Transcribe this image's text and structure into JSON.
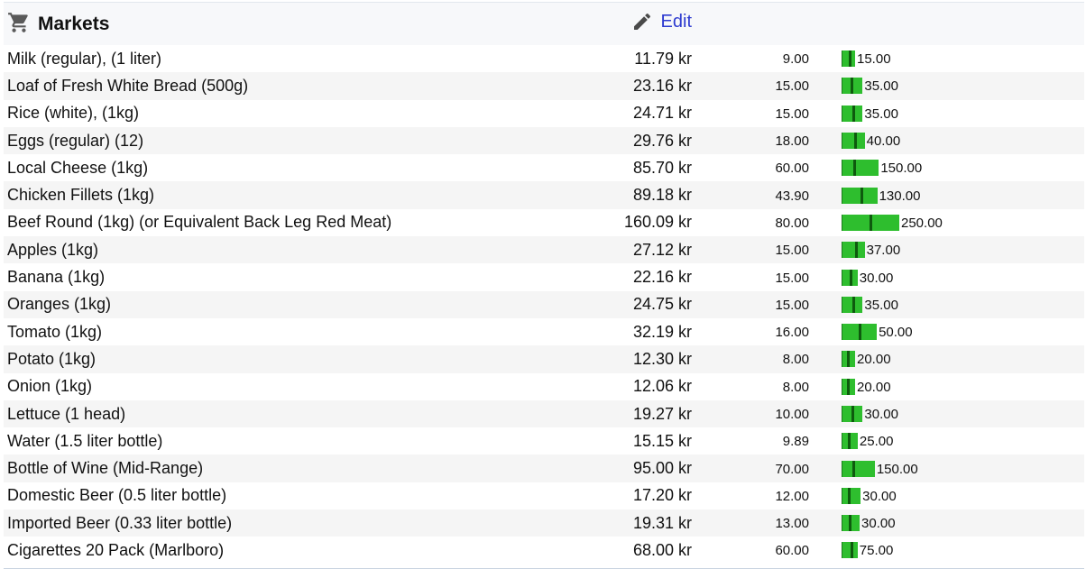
{
  "category": {
    "title": "Markets",
    "icon": "shopping-cart-icon",
    "edit_label": "Edit",
    "edit_icon": "pencil-icon"
  },
  "colors": {
    "bar": "#2ebe2e",
    "bar_marker": "#0e5a0e",
    "link": "#2e3bd0",
    "row_alt": "#f5f5f5"
  },
  "items": [
    {
      "name": "Milk (regular), (1 liter)",
      "price": "11.79 kr",
      "min": "9.00",
      "max": "15.00"
    },
    {
      "name": "Loaf of Fresh White Bread (500g)",
      "price": "23.16 kr",
      "min": "15.00",
      "max": "35.00"
    },
    {
      "name": "Rice (white), (1kg)",
      "price": "24.71 kr",
      "min": "15.00",
      "max": "35.00"
    },
    {
      "name": "Eggs (regular) (12)",
      "price": "29.76 kr",
      "min": "18.00",
      "max": "40.00"
    },
    {
      "name": "Local Cheese (1kg)",
      "price": "85.70 kr",
      "min": "60.00",
      "max": "150.00"
    },
    {
      "name": "Chicken Fillets (1kg)",
      "price": "89.18 kr",
      "min": "43.90",
      "max": "130.00"
    },
    {
      "name": "Beef Round (1kg) (or Equivalent Back Leg Red Meat)",
      "price": "160.09 kr",
      "min": "80.00",
      "max": "250.00"
    },
    {
      "name": "Apples (1kg)",
      "price": "27.12 kr",
      "min": "15.00",
      "max": "37.00"
    },
    {
      "name": "Banana (1kg)",
      "price": "22.16 kr",
      "min": "15.00",
      "max": "30.00"
    },
    {
      "name": "Oranges (1kg)",
      "price": "24.75 kr",
      "min": "15.00",
      "max": "35.00"
    },
    {
      "name": "Tomato (1kg)",
      "price": "32.19 kr",
      "min": "16.00",
      "max": "50.00"
    },
    {
      "name": "Potato (1kg)",
      "price": "12.30 kr",
      "min": "8.00",
      "max": "20.00"
    },
    {
      "name": "Onion (1kg)",
      "price": "12.06 kr",
      "min": "8.00",
      "max": "20.00"
    },
    {
      "name": "Lettuce (1 head)",
      "price": "19.27 kr",
      "min": "10.00",
      "max": "30.00"
    },
    {
      "name": "Water (1.5 liter bottle)",
      "price": "15.15 kr",
      "min": "9.89",
      "max": "25.00"
    },
    {
      "name": "Bottle of Wine (Mid-Range)",
      "price": "95.00 kr",
      "min": "70.00",
      "max": "150.00"
    },
    {
      "name": "Domestic Beer (0.5 liter bottle)",
      "price": "17.20 kr",
      "min": "12.00",
      "max": "30.00"
    },
    {
      "name": "Imported Beer (0.33 liter bottle)",
      "price": "19.31 kr",
      "min": "13.00",
      "max": "30.00"
    },
    {
      "name": "Cigarettes 20 Pack (Marlboro)",
      "price": "68.00 kr",
      "min": "60.00",
      "max": "75.00"
    }
  ]
}
